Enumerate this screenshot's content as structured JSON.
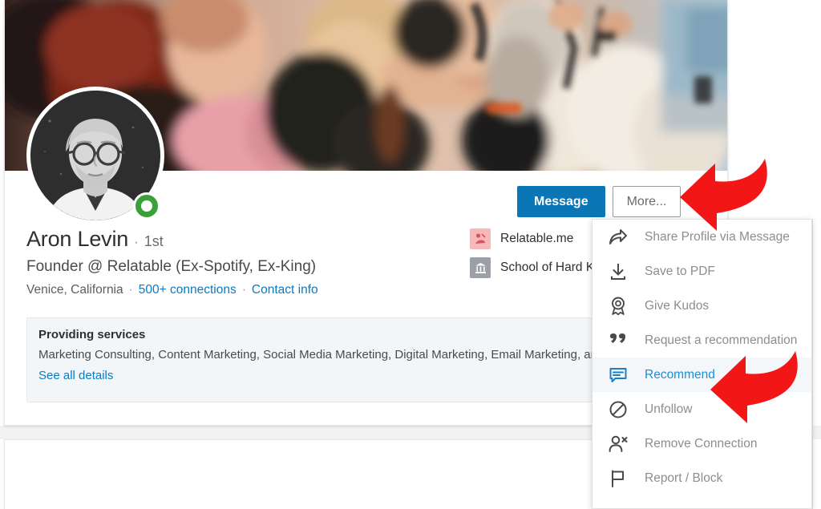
{
  "profile": {
    "name": "Aron Levin",
    "separator_dot": "·",
    "degree": "1st",
    "headline": "Founder @ Relatable (Ex-Spotify, Ex-King)",
    "location": "Venice, California",
    "connections": "500+ connections",
    "contact_info": "Contact info",
    "avatar_alt": "profile-photo",
    "status_badge": "open-to-work-ring",
    "cover_alt": "cover-photo-crowd"
  },
  "entities": [
    {
      "name": "Relatable.me",
      "logo": "company-logo",
      "logo_color": "#f6b9b9"
    },
    {
      "name": "School of Hard K",
      "logo": "school-building-icon",
      "logo_color": "#9aa0a6"
    }
  ],
  "actions": {
    "message_label": "Message",
    "more_label": "More..."
  },
  "services": {
    "title": "Providing services",
    "list": "Marketing Consulting, Content Marketing, Social Media Marketing, Digital Marketing, Email Marketing, and Marketing",
    "see_all_label": "See all details"
  },
  "dropdown": {
    "items": [
      {
        "label": "Share Profile via Message",
        "icon": "share-arrow-icon",
        "active": false
      },
      {
        "label": "Save to PDF",
        "icon": "download-icon",
        "active": false
      },
      {
        "label": "Give Kudos",
        "icon": "award-ribbon-icon",
        "active": false
      },
      {
        "label": "Request a recommendation",
        "icon": "quote-marks-icon",
        "active": false
      },
      {
        "label": "Recommend",
        "icon": "speech-bubble-icon",
        "active": true
      },
      {
        "label": "Unfollow",
        "icon": "block-circle-icon",
        "active": false
      },
      {
        "label": "Remove Connection",
        "icon": "person-remove-icon",
        "active": false
      },
      {
        "label": "Report / Block",
        "icon": "flag-icon",
        "active": false
      }
    ]
  },
  "annotations": {
    "arrow_top": "red-arrow-pointing-to-more-button",
    "arrow_bottom": "red-arrow-pointing-to-recommend"
  },
  "colors": {
    "linkedin_blue": "#0a76b5",
    "link_blue": "#0a7bc0",
    "active_blue": "#1c8fd6",
    "status_green": "#3aa03a",
    "arrow_red": "#f21616"
  }
}
